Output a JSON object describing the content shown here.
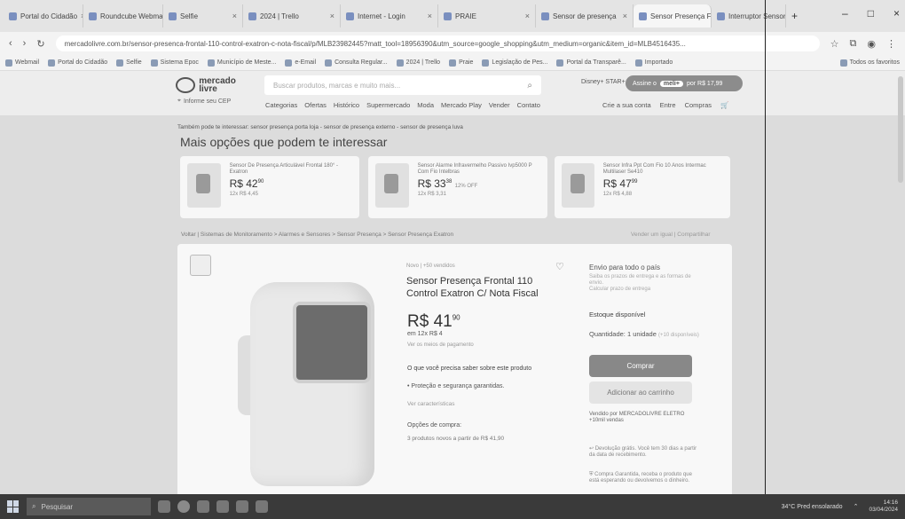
{
  "browser": {
    "tabs": [
      {
        "label": "Portal do Cidadão"
      },
      {
        "label": "Roundcube Webmail"
      },
      {
        "label": "Selfie"
      },
      {
        "label": "2024 | Trello"
      },
      {
        "label": "Internet - Login"
      },
      {
        "label": "PRAIE"
      },
      {
        "label": "Sensor de presença"
      },
      {
        "label": "Sensor Presença Fr"
      },
      {
        "label": "Interruptor Sensor"
      }
    ],
    "url": "mercadolivre.com.br/sensor-presenca-frontal-110-control-exatron-c-nota-fiscal/p/MLB23982445?matt_tool=18956390&utm_source=google_shopping&utm_medium=organic&item_id=MLB4516435...",
    "bookmarks": [
      "Webmail",
      "Portal do Cidadão",
      "Selfie",
      "Sistema Epoc",
      "Município de Meste...",
      "e-Email",
      "Consulta Regular...",
      "2024 | Trello",
      "Praie",
      "Legislação de Pes...",
      "Portal da Transparê...",
      "Importado"
    ],
    "bookmarks_right": "Todos os favoritos"
  },
  "ml": {
    "logo_text": "mercado livre",
    "search_placeholder": "Buscar produtos, marcas e muito mais...",
    "disney_text": "Disney+ STAR+",
    "promo_text": "Assine o",
    "promo_badge": "meli+",
    "promo_price": "por R$ 17,99",
    "cep_label": "Informe seu CEP",
    "nav": [
      "Categorias",
      "Ofertas",
      "Histórico",
      "Supermercado",
      "Moda",
      "Mercado Play",
      "Vender",
      "Contato"
    ],
    "nav_right": [
      "Crie a sua conta",
      "Entre",
      "Compras"
    ]
  },
  "content": {
    "also_searched": "Também pode te interessar: sensor presença porta loja - sensor de presença externo - sensor de presença luva",
    "more_title": "Mais opções que podem te interessar",
    "recommendations": [
      {
        "title": "Sensor De Presença Articulável Frontal 180° - Exatron",
        "price": "R$ 42",
        "cents": "90",
        "installments": "12x R$ 4,45"
      },
      {
        "title": "Sensor Alarme Infravermelho Passivo Ivp5000 P Com Fio Intelbras",
        "price": "R$ 33",
        "cents": "38",
        "installments": "12x R$ 3,31",
        "discount": "12% OFF"
      },
      {
        "title": "Sensor Infra Ppt Com Fio 10 Anos Intermac Multilaser Se410",
        "price": "R$ 47",
        "cents": "99",
        "installments": "12x R$ 4,88"
      }
    ],
    "breadcrumb": "Voltar | Sistemas de Monitoramento > Alarmes e Sensores > Sensor Presença > Sensor Presença Exatron",
    "breadcrumb_right": "Vender um igual | Compartilhar",
    "product": {
      "status": "Novo | +50 vendidos",
      "title": "Sensor Presença Frontal 110 Control Exatron C/ Nota Fiscal",
      "price": "R$ 41",
      "cents": "90",
      "installments": "em 12x R$ 4",
      "payment_info": "Ver os meios de pagamento",
      "need_to_know": "O que você precisa saber sobre este produto",
      "bullet": "• Proteção e segurança garantidas.",
      "see_more": "Ver características",
      "buy_options": "Opções de compra:",
      "new_from": "3 produtos novos a partir de R$ 41,90"
    },
    "purchase": {
      "shipping": "Envio para todo o país",
      "shipping_sub": "Saiba os prazos de entrega e as formas de envio.",
      "calc_shipping": "Calcular prazo de entrega",
      "stock": "Estoque disponível",
      "qty_label": "Quantidade: 1 unidade",
      "qty_available": "(+10 disponíveis)",
      "buy": "Comprar",
      "add_cart": "Adicionar ao carrinho",
      "seller": "Vendido por MERCADOLIVRE ELETRO +10mil vendas",
      "return": "Devolução grátis. Você tem 30 dias a partir da data de recebimento.",
      "guarantee": "Compra Garantida, receba o produto que está esperando ou devolvemos o dinheiro."
    }
  },
  "taskbar": {
    "search": "Pesquisar",
    "weather": "34°C Pred ensolarado",
    "time": "14:16",
    "date": "03/04/2024"
  }
}
